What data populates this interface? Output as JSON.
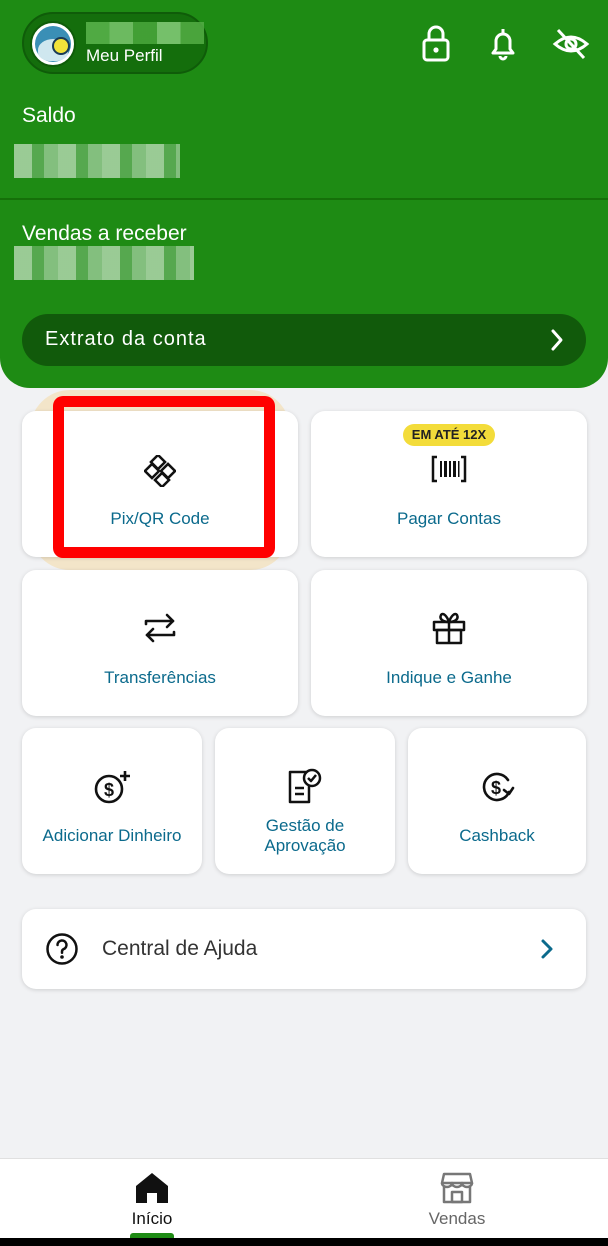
{
  "header": {
    "profile_subtitle": "Meu Perfil",
    "balance_label": "Saldo",
    "receivables_label": "Vendas a receber",
    "statement_button": "Extrato da conta"
  },
  "actions": [
    {
      "label": "Pix/QR Code",
      "icon": "pix-icon"
    },
    {
      "label": "Pagar Contas",
      "icon": "barcode-icon",
      "badge": "EM ATÉ 12X"
    },
    {
      "label": "Transferências",
      "icon": "transfer-arrows-icon"
    },
    {
      "label": "Indique e Ganhe",
      "icon": "gift-icon"
    },
    {
      "label": "Adicionar Dinheiro",
      "icon": "add-money-icon"
    },
    {
      "label_line1": "Gestão de",
      "label_line2": "Aprovação",
      "icon": "approval-document-icon"
    },
    {
      "label": "Cashback",
      "icon": "cashback-icon"
    }
  ],
  "help": {
    "label": "Central de Ajuda",
    "icon": "help-icon"
  },
  "bottom_nav": [
    {
      "label": "Início",
      "icon": "home-icon",
      "active": true
    },
    {
      "label": "Vendas",
      "icon": "store-icon",
      "active": false
    }
  ],
  "colors": {
    "header_green": "#1e8b14",
    "dark_green": "#115a0b",
    "link_blue": "#0b6a8c",
    "badge_yellow": "#f3dc3a",
    "highlight_red": "#ff0000"
  }
}
